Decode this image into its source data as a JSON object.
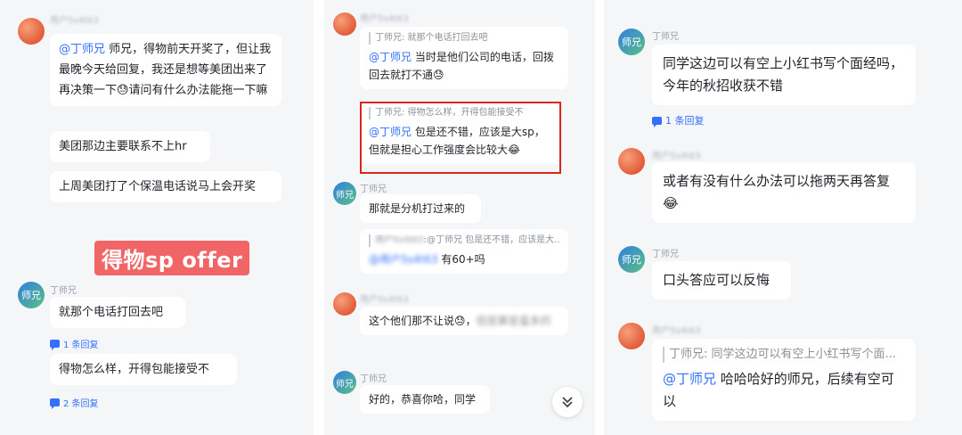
{
  "sender": "丁师兄",
  "avatar_text": "师兄",
  "blurred_user": "用户5s4t63",
  "panel1": {
    "msg1": {
      "mention": "@丁师兄",
      "text": " 师兄，得物前天开奖了，但让我最晚今天给回复，我还是想等美团出来了再决策一下😓请问有什么办法能拖一下嘛"
    },
    "msg2": "美团那边主要联系不上hr",
    "msg3": "上周美团打了个保温电话说马上会开奖",
    "badge": "得物sp offer",
    "msg4": "就那个电话打回去吧",
    "replies4": "1 条回复",
    "msg5": "得物怎么样，开得包能接受不",
    "replies5": "2 条回复"
  },
  "panel2": {
    "msg1": {
      "quote": "丁师兄: 就那个电话打回去吧",
      "mention": "@丁师兄",
      "text": " 当时是他们公司的电话，回拨回去就打不通😓"
    },
    "msg2": {
      "quote": "丁师兄: 得物怎么样，开得包能接受不",
      "mention": "@丁师兄",
      "text": " 包是还不错，应该是大sp，但就是担心工作强度会比较大😂"
    },
    "msg3": "那就是分机打过来的",
    "msg4": {
      "quote_user": "用户5s4t63",
      "quote_text": ":@丁师兄 包是还不错，应该是大...",
      "mention": "@用户5s4t63",
      "text": " 有60+吗"
    },
    "msg5": {
      "text": "这个他们那不让说😓，",
      "blurred": "但是算是蛮多的"
    },
    "msg6": "好的，恭喜你哈，同学"
  },
  "panel3": {
    "msg1": "同学这边可以有空上小红书写个面经吗，今年的秋招收获不错",
    "replies1": "1 条回复",
    "msg2": "或者有没有什么办法可以拖两天再答复😂",
    "msg3": "口头答应可以反悔",
    "msg4": {
      "quote": "丁师兄: 同学这边可以有空上小红书写个面...",
      "mention": "@丁师兄",
      "text": " 哈哈哈好的师兄，后续有空可以"
    }
  },
  "colors": {
    "accent": "#3370ff",
    "badge": "#f26566",
    "highlight_box": "#d9261c",
    "panel_bg": "#f5f6f8"
  },
  "icons": [
    "reply-thread-icon",
    "scroll-down-icon"
  ]
}
